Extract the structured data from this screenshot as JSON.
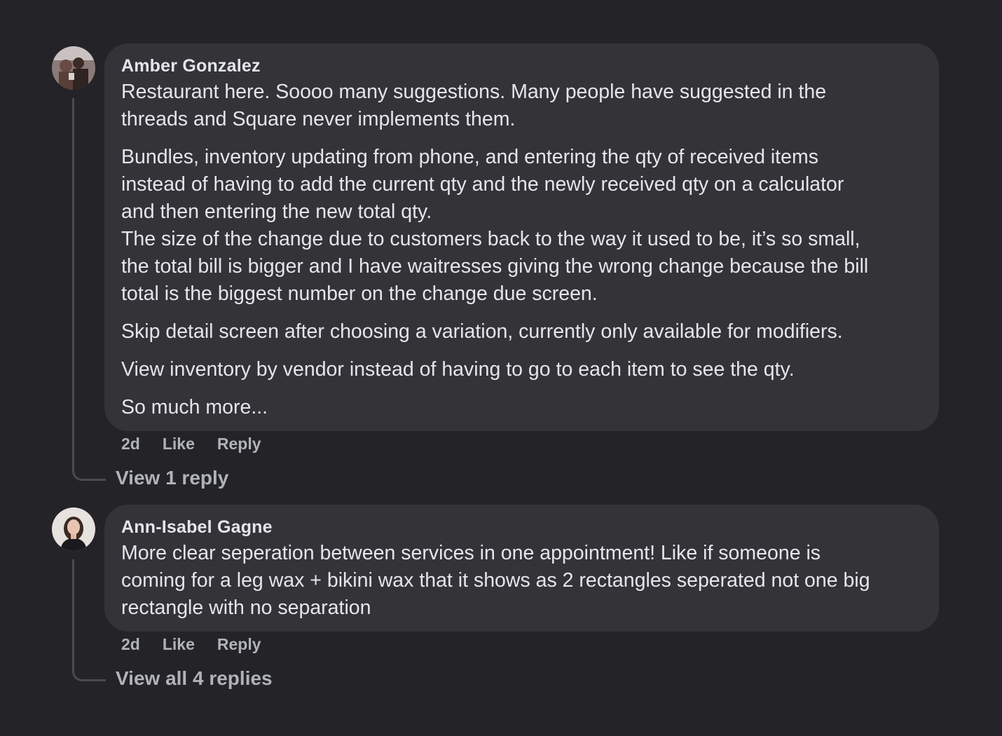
{
  "comments": [
    {
      "author": "Amber Gonzalez",
      "avatar_icon": "profile-photo-avatar",
      "paragraphs": [
        "Restaurant here. Soooo many suggestions. Many people have suggested in the\nthreads and Square never implements them.",
        "Bundles, inventory updating from phone, and entering the qty of received items\ninstead of having to add the current qty and the newly received qty on a calculator\nand then entering the new total qty.",
        "The size of the change due to customers back to the way it used to be, it’s so small,\nthe total bill is bigger and I have waitresses giving the wrong change because the bill\ntotal is the biggest number on the change due screen.",
        "Skip detail screen after choosing a variation, currently only available for modifiers.",
        "View inventory by vendor instead of having to go to each item to see the qty.",
        "So much more..."
      ],
      "time": "2d",
      "like_label": "Like",
      "reply_label": "Reply",
      "view_replies_label": "View 1 reply"
    },
    {
      "author": "Ann-Isabel Gagne",
      "avatar_icon": "profile-photo-avatar",
      "paragraphs": [
        "More clear seperation between services in one appointment! Like if someone is\ncoming for a leg wax + bikini wax that it shows as 2 rectangles seperated not one big\nrectangle with no separation"
      ],
      "time": "2d",
      "like_label": "Like",
      "reply_label": "Reply",
      "view_replies_label": "View all 4 replies"
    }
  ],
  "colors": {
    "background": "#232328",
    "bubble": "#333338",
    "text": "#e4e6eb",
    "muted": "#b0b3b8",
    "thread_line": "#4a4b50"
  }
}
